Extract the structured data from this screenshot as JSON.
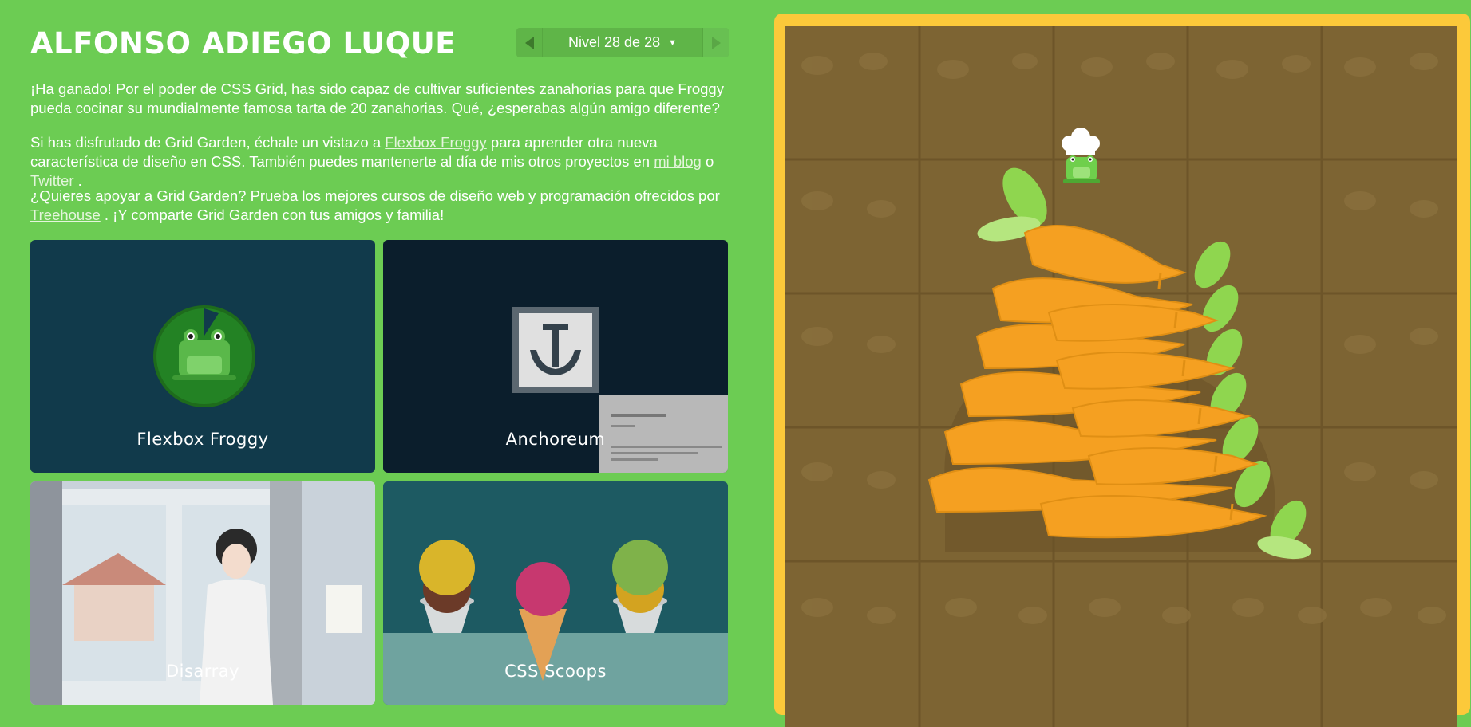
{
  "header": {
    "title": "ALFONSO ADIEGO LUQUE",
    "level": "Nivel 28 de 28"
  },
  "message": {
    "p1": "¡Ha ganado! Por el poder de CSS Grid, has sido capaz de cultivar suficientes zanahorias para que Froggy pueda cocinar su mundialmente famosa tarta de 20 zanahorias. Qué, ¿esperabas algún amigo diferente?",
    "p2_pre": "Si has disfrutado de Grid Garden, échale un vistazo a ",
    "p2_link1": "Flexbox Froggy",
    "p2_mid": " para aprender otra nueva característica de diseño en CSS. También puedes mantenerte al día de mis otros proyectos en ",
    "p2_link2": "mi blog",
    "p2_or": " o ",
    "p2_link3": "Twitter",
    "p2_end": " .",
    "p3_pre": "¿Quieres apoyar a Grid Garden? Prueba los mejores cursos de diseño web y programación ofrecidos por ",
    "p3_link": "Treehouse",
    "p3_end": " . ¡Y comparte Grid Garden con tus amigos y familia!"
  },
  "cards": [
    {
      "label": "Flexbox Froggy"
    },
    {
      "label": "Anchoreum"
    },
    {
      "label": "Disarray"
    },
    {
      "label": "CSS Scoops"
    }
  ],
  "colors": {
    "background": "#6ccc53",
    "board_border": "#fcc93a",
    "soil": "#7d6433",
    "carrot": "#f5a021",
    "leaf": "#8fd64f"
  },
  "icons": [
    "chevron-left-icon",
    "chevron-right-icon",
    "caret-down-icon",
    "frog-icon",
    "anchor-icon",
    "chef-frog-icon",
    "carrot-icon"
  ]
}
